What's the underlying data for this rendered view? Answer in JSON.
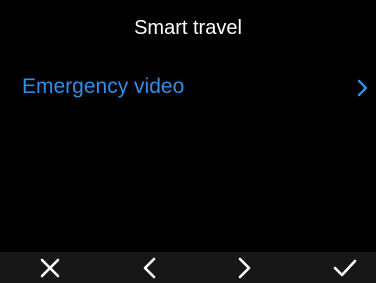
{
  "header": {
    "title": "Smart travel"
  },
  "menu": {
    "items": [
      {
        "label": "Emergency video",
        "icon": "chevron-right-icon"
      }
    ]
  },
  "bottom_bar": {
    "buttons": [
      {
        "name": "cancel",
        "icon": "close-icon"
      },
      {
        "name": "previous",
        "icon": "chevron-left-icon"
      },
      {
        "name": "next",
        "icon": "chevron-right-icon"
      },
      {
        "name": "confirm",
        "icon": "check-icon"
      }
    ]
  },
  "colors": {
    "background": "#000000",
    "accent": "#2f8fe6",
    "text": "#ffffff",
    "bar": "#171717"
  }
}
